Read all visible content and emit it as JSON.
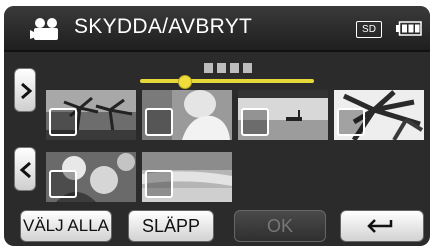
{
  "header": {
    "title": "SKYDDA/AVBRYT",
    "media_badge": "SD",
    "mode_icon": "video-camera-icon",
    "battery_icon": "battery-full-icon"
  },
  "scrubber": {
    "position": 0.25,
    "track_color": "#e6d83a"
  },
  "thumbnails": [
    {
      "scene": "palm-trees-silhouette",
      "selected": false
    },
    {
      "scene": "woman-portrait",
      "selected": false
    },
    {
      "scene": "sunset-boat-lake",
      "selected": false
    },
    {
      "scene": "palm-leaves-bright-sky",
      "selected": false
    },
    {
      "scene": "flowers-closeup",
      "selected": false
    },
    {
      "scene": "beach-waves",
      "selected": false
    }
  ],
  "footer": {
    "select_all_label": "VÄLJ ALLA",
    "release_label": "SLÄPP",
    "ok_label": "OK",
    "back_icon": "return-arrow-icon"
  }
}
